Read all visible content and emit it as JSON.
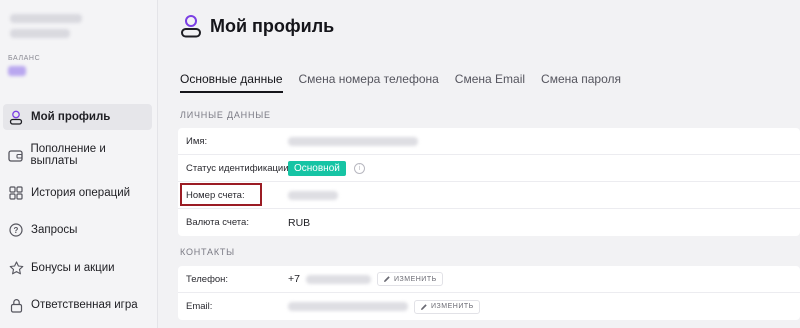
{
  "sidebar": {
    "balance_label": "БАЛАНС",
    "items": [
      {
        "label": "Мой профиль",
        "icon": "user-icon",
        "active": true
      },
      {
        "label": "Пополнение и выплаты",
        "icon": "wallet-icon",
        "active": false
      },
      {
        "label": "История операций",
        "icon": "grid-icon",
        "active": false
      },
      {
        "label": "Запросы",
        "icon": "question-icon",
        "active": false
      },
      {
        "label": "Бонусы и акции",
        "icon": "star-icon",
        "active": false
      },
      {
        "label": "Ответственная игра",
        "icon": "lock-icon",
        "active": false
      }
    ]
  },
  "header": {
    "title": "Мой профиль",
    "icon": "user-icon",
    "accent_color": "#7b3fe4"
  },
  "tabs": [
    {
      "label": "Основные данные",
      "active": true
    },
    {
      "label": "Смена номера телефона",
      "active": false
    },
    {
      "label": "Смена Email",
      "active": false
    },
    {
      "label": "Смена пароля",
      "active": false
    }
  ],
  "personal": {
    "title": "ЛИЧНЫЕ ДАННЫЕ",
    "name_label": "Имя:",
    "status_label": "Статус идентификации:",
    "status_value": "Основной",
    "status_color": "#16c4a4",
    "account_label": "Номер счета:",
    "currency_label": "Валюта счета:",
    "currency_value": "RUB"
  },
  "contacts": {
    "title": "КОНТАКТЫ",
    "phone_label": "Телефон:",
    "phone_prefix": "+7",
    "email_label": "Email:",
    "edit_label": "ИЗМЕНИТЬ"
  }
}
